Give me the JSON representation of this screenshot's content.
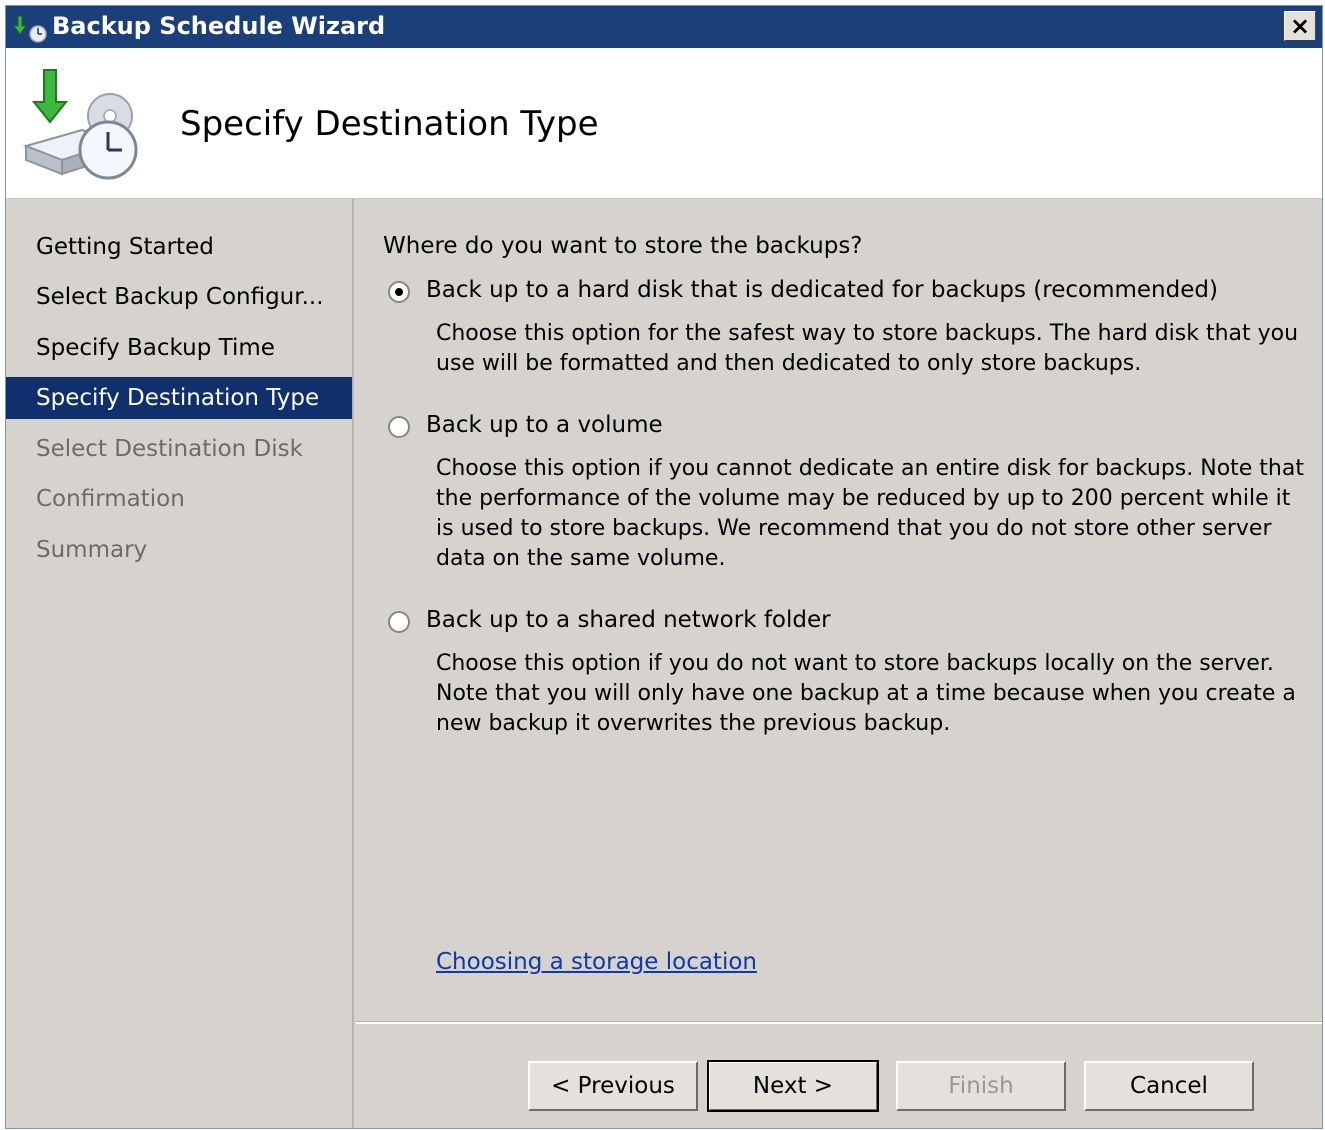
{
  "window": {
    "title": "Backup Schedule Wizard",
    "close_label": "×"
  },
  "header": {
    "title": "Specify Destination Type"
  },
  "nav": {
    "items": [
      {
        "label": "Getting Started",
        "state": "normal"
      },
      {
        "label": "Select Backup Configur...",
        "state": "normal"
      },
      {
        "label": "Specify Backup Time",
        "state": "normal"
      },
      {
        "label": "Specify Destination Type",
        "state": "active"
      },
      {
        "label": "Select Destination Disk",
        "state": "disabled"
      },
      {
        "label": "Confirmation",
        "state": "disabled"
      },
      {
        "label": "Summary",
        "state": "disabled"
      }
    ]
  },
  "content": {
    "question": "Where do you want to store the backups?",
    "options": [
      {
        "label": "Back up to a hard disk that is dedicated for backups (recommended)",
        "description": "Choose this option for the safest way to store backups. The hard disk that you use will be formatted and then dedicated to only store backups.",
        "selected": true
      },
      {
        "label": "Back up to a volume",
        "description": "Choose this option if you cannot dedicate an entire disk for backups. Note that the performance of the volume may be reduced by up to 200 percent while it is used to store backups. We recommend that you do not store other server data on the same volume.",
        "selected": false
      },
      {
        "label": "Back up to a shared network folder",
        "description": "Choose this option if you do not want to store backups locally on the server. Note that you will only have one backup at a time because when you create a new backup it overwrites the previous backup.",
        "selected": false
      }
    ],
    "help_link": "Choosing a storage location"
  },
  "buttons": {
    "previous": "< Previous",
    "next": "Next >",
    "finish": "Finish",
    "cancel": "Cancel"
  },
  "colors": {
    "titlebar": "#1a3f7a",
    "nav_active": "#10306d",
    "window_bg": "#d6d3ce",
    "link": "#0c3aa8"
  }
}
